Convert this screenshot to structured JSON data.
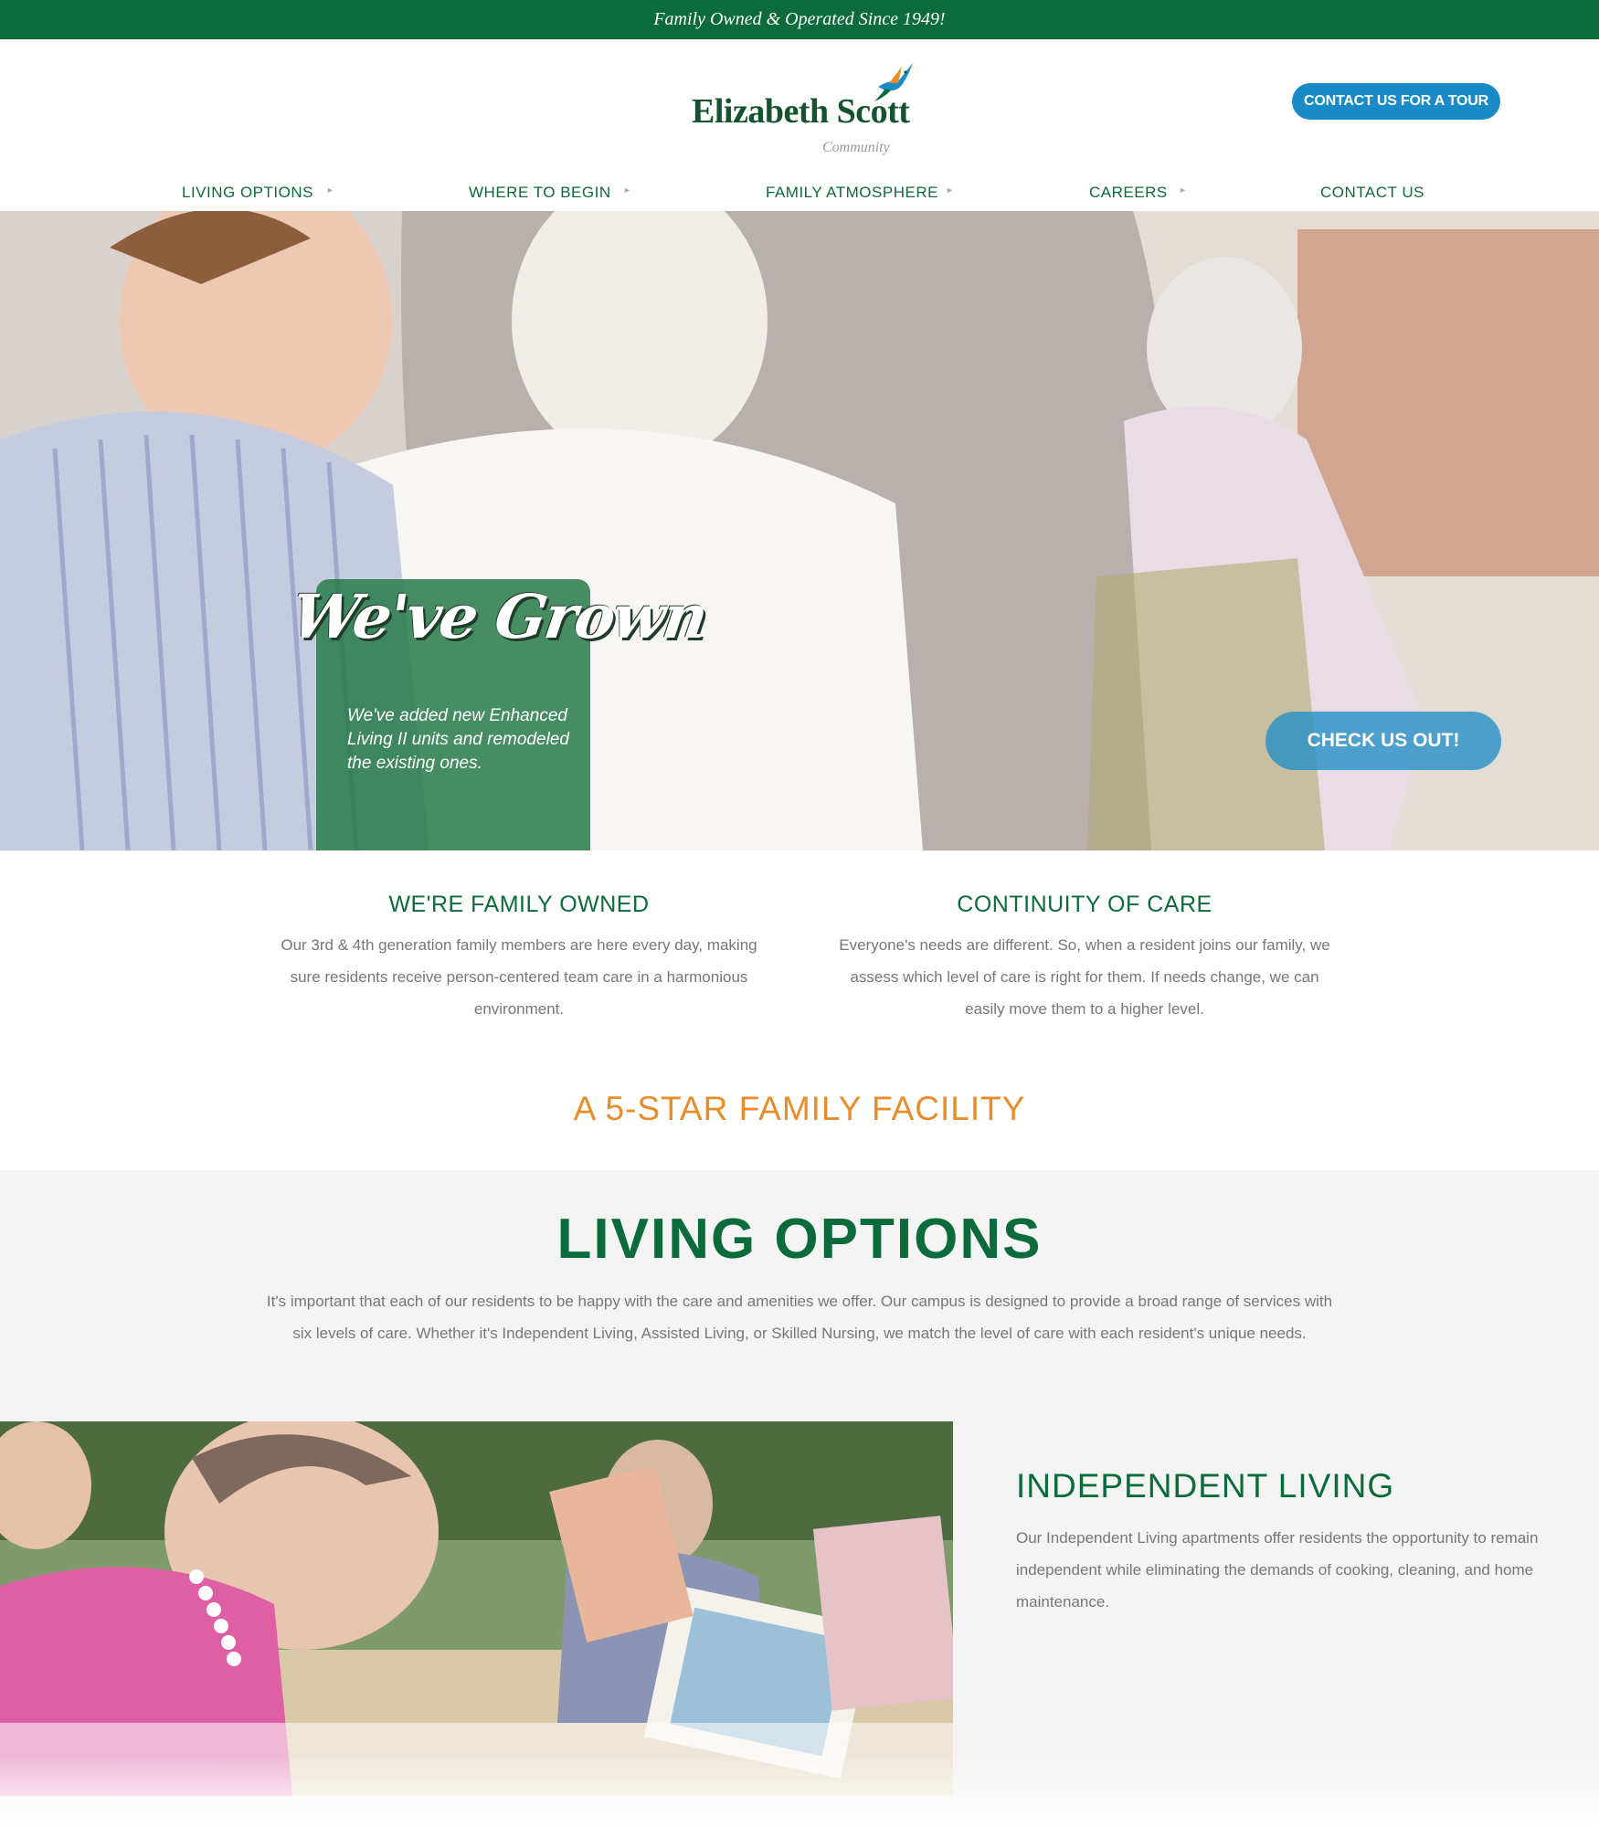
{
  "topbar": {
    "text": "Family Owned & Operated Since 1949!"
  },
  "header": {
    "logo_name": "Elizabeth Scott",
    "logo_sub": "Community",
    "tour_button": "CONTACT US FOR A TOUR"
  },
  "nav": {
    "items": [
      {
        "label": "LIVING OPTIONS",
        "has_submenu": true
      },
      {
        "label": "WHERE TO BEGIN",
        "has_submenu": true
      },
      {
        "label": "FAMILY ATMOSPHERE",
        "has_submenu": true
      },
      {
        "label": "CAREERS",
        "has_submenu": true
      },
      {
        "label": "CONTACT US",
        "has_submenu": false
      }
    ]
  },
  "hero": {
    "title": "We've Grown",
    "text": "We've added new Enhanced Living II units and remodeled the existing ones.",
    "button": "CHECK US OUT!"
  },
  "features": [
    {
      "title": "WE'RE FAMILY OWNED",
      "text": "Our 3rd & 4th generation family members are here every day, making sure residents receive person-centered team care in a harmonious environment."
    },
    {
      "title": "CONTINUITY OF CARE",
      "text": "Everyone's needs are different. So, when a resident joins our family, we assess which level of care is right for them. If needs change, we can easily move them to a higher level."
    }
  ],
  "tagline": "A 5-STAR FAMILY FACILITY",
  "living_options": {
    "title": "LIVING OPTIONS",
    "description": "It's important that each of our residents to be happy with the care and amenities we offer. Our campus is designed to provide a broad range of services with six levels of care. Whether it's Independent Living, Assisted Living, or Skilled Nursing, we match the level of care with each resident's unique needs.",
    "independent": {
      "title": "INDEPENDENT LIVING",
      "text": "Our Independent Living apartments offer residents the opportunity to remain independent while eliminating the demands of cooking, cleaning, and home maintenance."
    }
  },
  "colors": {
    "brand_green": "#0b6b3a",
    "accent_blue": "#1a8bc7",
    "accent_orange": "#e98d2a"
  }
}
